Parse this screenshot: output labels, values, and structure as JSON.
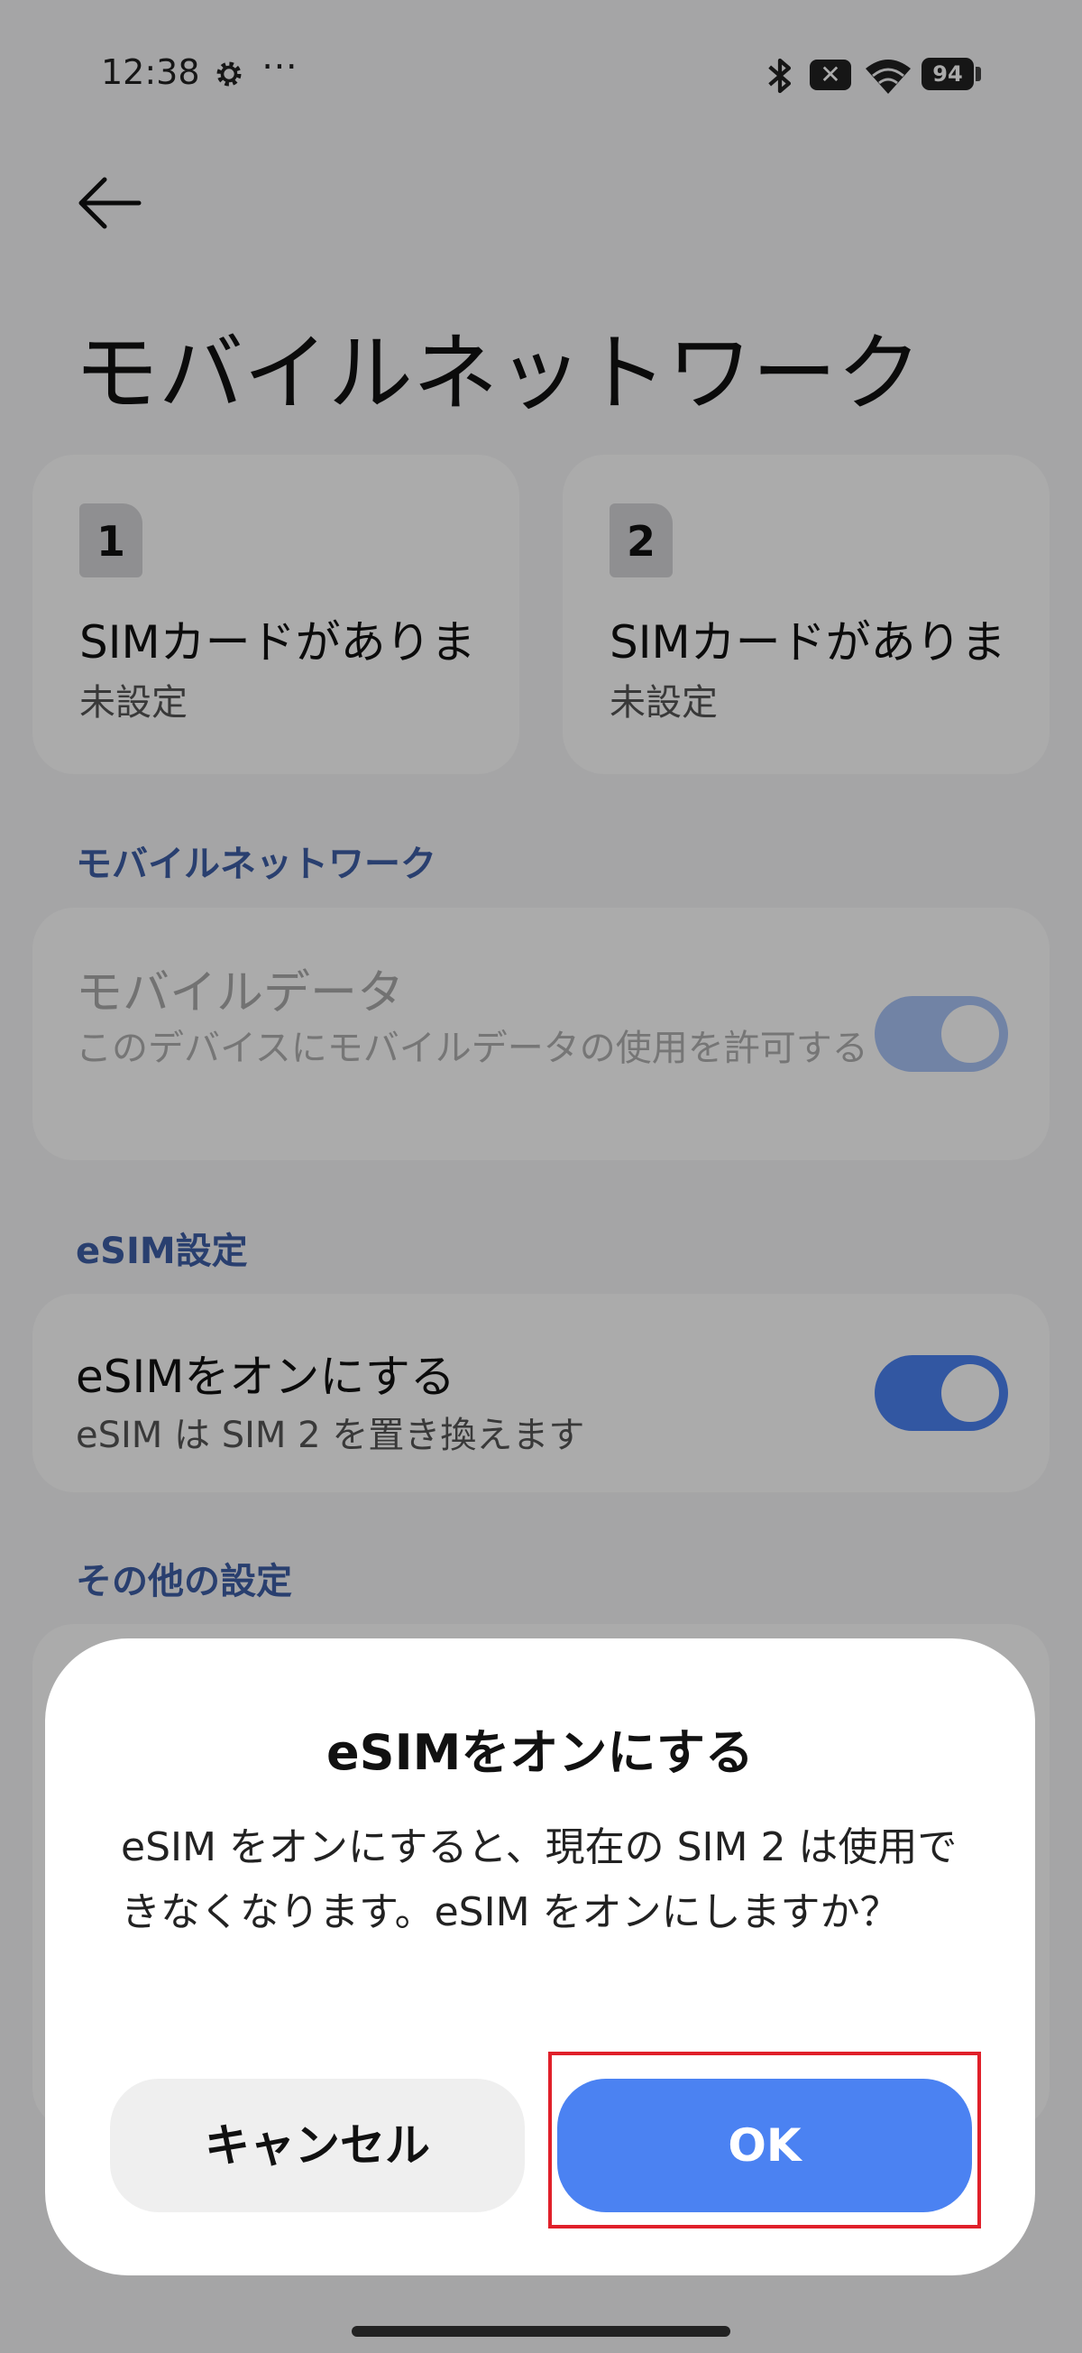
{
  "status_bar": {
    "time": "12:38",
    "overflow": "⋯",
    "battery": "94",
    "notification_x": "✕"
  },
  "page": {
    "title": "モバイルネットワーク"
  },
  "sims": [
    {
      "number": "1",
      "title": "SIMカードがありま",
      "status": "未設定"
    },
    {
      "number": "2",
      "title": "SIMカードがありま",
      "status": "未設定"
    }
  ],
  "mobile_network": {
    "section_label": "モバイルネットワーク",
    "mobile_data_title": "モバイルデータ",
    "mobile_data_desc": "このデバイスにモバイルデータの使用を許可する",
    "mobile_data_on": true
  },
  "esim": {
    "section_label": "eSIM設定",
    "toggle_title": "eSIMをオンにする",
    "toggle_desc": "eSIM は SIM 2 を置き換えます",
    "toggle_on": true
  },
  "other": {
    "section_label": "その他の設定"
  },
  "dialog": {
    "title": "eSIMをオンにする",
    "body": "eSIM をオンにすると、現在の SIM 2 は使用できなくなります。eSIM をオンにしますか？",
    "cancel_label": "キャンセル",
    "ok_label": "OK"
  },
  "colors": {
    "accent": "#4b82f2",
    "section_label": "#3e5fa6",
    "highlight": "#e0202a"
  }
}
